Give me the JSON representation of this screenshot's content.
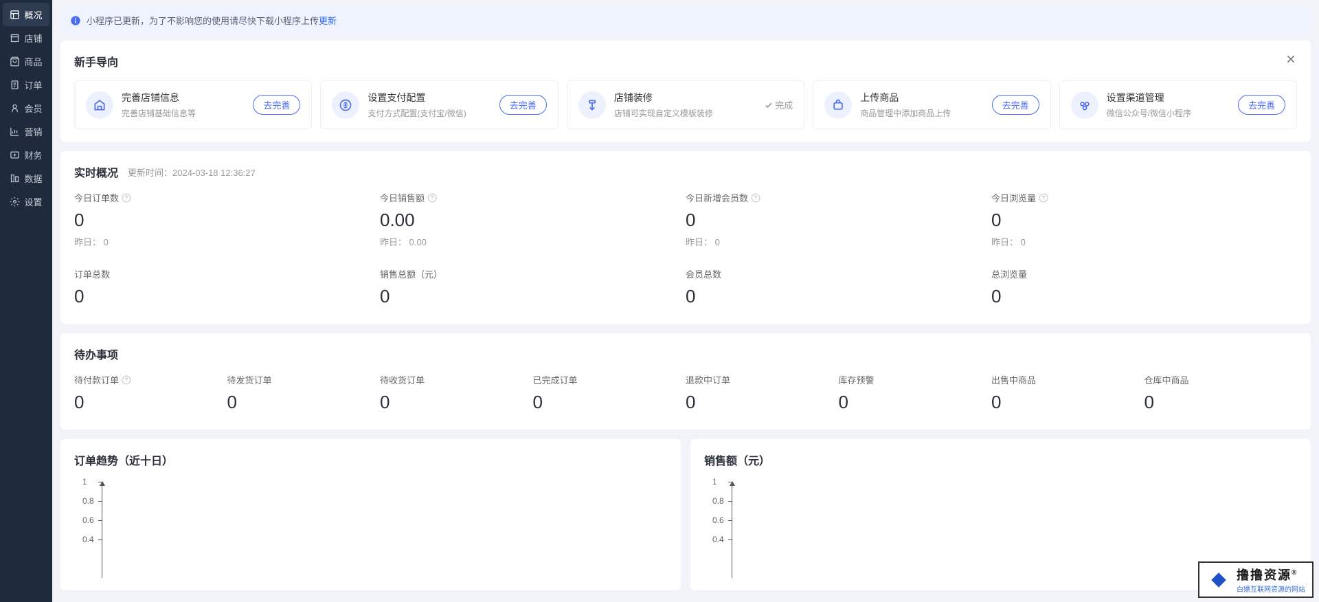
{
  "sidebar": {
    "items": [
      {
        "label": "概况",
        "icon": "dashboard"
      },
      {
        "label": "店铺",
        "icon": "shop"
      },
      {
        "label": "商品",
        "icon": "bag"
      },
      {
        "label": "订单",
        "icon": "order"
      },
      {
        "label": "会员",
        "icon": "user"
      },
      {
        "label": "营销",
        "icon": "chart"
      },
      {
        "label": "财务",
        "icon": "money"
      },
      {
        "label": "数据",
        "icon": "data"
      },
      {
        "label": "设置",
        "icon": "gear"
      }
    ]
  },
  "notice": {
    "text": "小程序已更新，为了不影响您的使用请尽快下载小程序上传",
    "link": "更新"
  },
  "guide": {
    "title": "新手导向",
    "items": [
      {
        "title": "完善店铺信息",
        "desc": "完善店铺基础信息等",
        "action": "去完善",
        "done": false
      },
      {
        "title": "设置支付配置",
        "desc": "支付方式配置(支付宝/微信)",
        "action": "去完善",
        "done": false
      },
      {
        "title": "店铺装修",
        "desc": "店铺可实现自定义模板装修",
        "action": "完成",
        "done": true
      },
      {
        "title": "上传商品",
        "desc": "商品管理中添加商品上传",
        "action": "去完善",
        "done": false
      },
      {
        "title": "设置渠道管理",
        "desc": "微信公众号/微信小程序",
        "action": "去完善",
        "done": false
      }
    ]
  },
  "realtime": {
    "title": "实时概况",
    "update_label": "更新时间：",
    "update_time": "2024-03-18 12:36:27",
    "row1": [
      {
        "label": "今日订单数",
        "value": "0",
        "sub": "昨日： 0",
        "help": true
      },
      {
        "label": "今日销售额",
        "value": "0.00",
        "sub": "昨日： 0.00",
        "help": true
      },
      {
        "label": "今日新增会员数",
        "value": "0",
        "sub": "昨日： 0",
        "help": true
      },
      {
        "label": "今日浏览量",
        "value": "0",
        "sub": "昨日： 0",
        "help": true
      }
    ],
    "row2": [
      {
        "label": "订单总数",
        "value": "0"
      },
      {
        "label": "销售总额（元）",
        "value": "0"
      },
      {
        "label": "会员总数",
        "value": "0"
      },
      {
        "label": "总浏览量",
        "value": "0"
      }
    ]
  },
  "todo": {
    "title": "待办事项",
    "items": [
      {
        "label": "待付款订单",
        "value": "0",
        "help": true
      },
      {
        "label": "待发货订单",
        "value": "0"
      },
      {
        "label": "待收货订单",
        "value": "0"
      },
      {
        "label": "已完成订单",
        "value": "0"
      },
      {
        "label": "退款中订单",
        "value": "0"
      },
      {
        "label": "库存预警",
        "value": "0"
      },
      {
        "label": "出售中商品",
        "value": "0"
      },
      {
        "label": "仓库中商品",
        "value": "0"
      }
    ]
  },
  "charts": {
    "left_title": "订单趋势（近十日）",
    "right_title": "销售额（元）"
  },
  "chart_data": [
    {
      "type": "line",
      "title": "订单趋势（近十日）",
      "ylim": [
        0,
        1
      ],
      "y_ticks": [
        0.4,
        0.6,
        0.8,
        1
      ],
      "series": [
        {
          "name": "orders",
          "values": []
        }
      ]
    },
    {
      "type": "line",
      "title": "销售额（元）",
      "ylim": [
        0,
        1
      ],
      "y_ticks": [
        0.4,
        0.6,
        0.8,
        1
      ],
      "series": [
        {
          "name": "sales",
          "values": []
        }
      ]
    }
  ],
  "watermark": {
    "t1": "撸撸资源",
    "t2": "白嫖互联网资源的网站",
    "r": "®"
  }
}
